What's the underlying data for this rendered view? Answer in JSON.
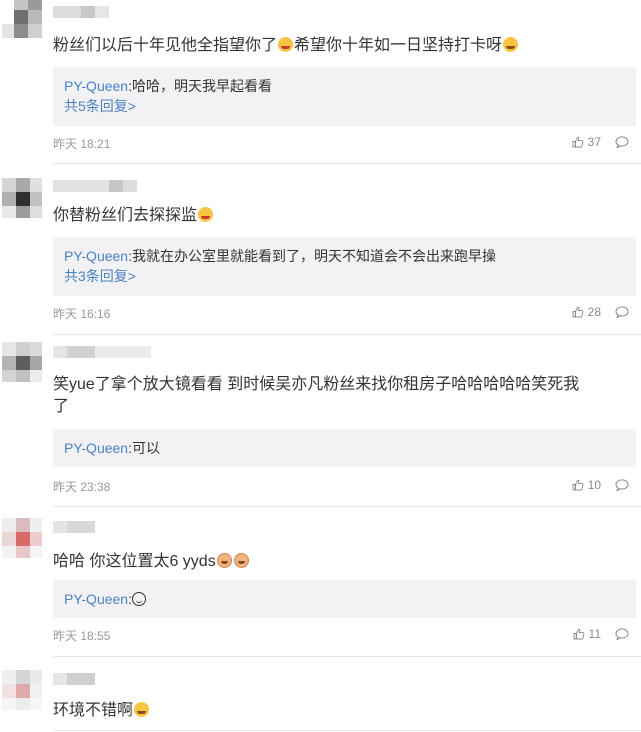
{
  "comments": [
    {
      "text": "粉丝们以后十年见他全指望你了",
      "text_after_emoji": "希望你十年如一日坚持打卡呀",
      "emoji": [
        "laugh-tears-emoji",
        "grin-emoji"
      ],
      "reply": {
        "name": "PY-Queen",
        "text": "哈哈，明天我早起看看",
        "more": "共5条回复>"
      },
      "date": "昨天 18:21",
      "likes": "37"
    },
    {
      "text": "你替粉丝们去探探监",
      "emoji": [
        "laugh-emoji"
      ],
      "reply": {
        "name": "PY-Queen",
        "text": "我就在办公室里就能看到了，明天不知道会不会出来跑早操",
        "more": "共3条回复>"
      },
      "date": "昨天 16:16",
      "likes": "28"
    },
    {
      "text_line1": "笑yue了拿个放大镜看看 到时候吴亦凡粉丝来找你租房子哈哈哈哈哈笑死我",
      "text_line2": "了",
      "reply": {
        "name": "PY-Queen",
        "text": "可以"
      },
      "date": "昨天 23:38",
      "likes": "10"
    },
    {
      "text": "哈哈 你这位置太6 yyds",
      "emoji": [
        "cat-emoji",
        "cat-emoji"
      ],
      "reply": {
        "name": "PY-Queen",
        "text": ""
      },
      "date": "昨天 18:55",
      "likes": "11"
    },
    {
      "text": "环境不错啊",
      "emoji": [
        "grin-emoji"
      ]
    }
  ],
  "colors": {
    "link": "#4a82c3",
    "reply_bg": "#f2f2f5",
    "meta": "#999999"
  }
}
